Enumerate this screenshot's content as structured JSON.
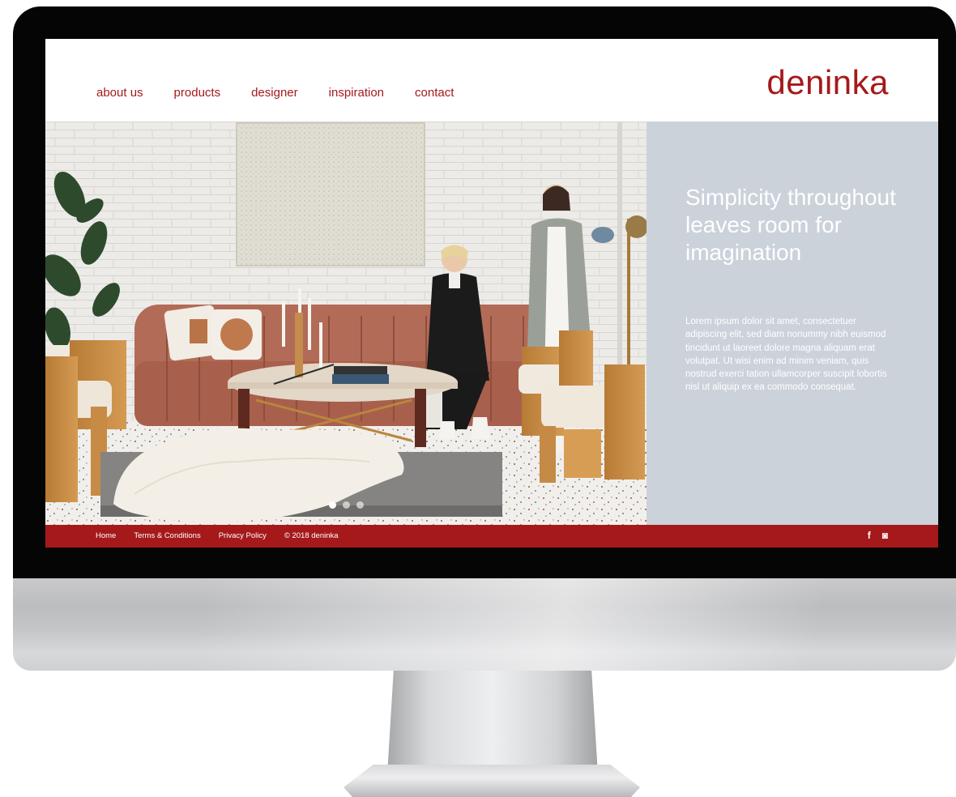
{
  "nav": {
    "items": [
      {
        "label": "about us"
      },
      {
        "label": "products"
      },
      {
        "label": "designer"
      },
      {
        "label": "inspiration"
      },
      {
        "label": "contact"
      }
    ]
  },
  "brand": {
    "logo_text": "deninka",
    "accent_color": "#a5191b",
    "panel_color": "#cbd2da"
  },
  "hero": {
    "headline": "Simplicity throughout leaves room for imagination",
    "body": "Lorem ipsum dolor sit amet, consectetuer adipiscing elit, sed diam nonummy nibh euismod tincidunt ut laoreet dolore magna aliquam erat volutpat. Ut wisi enim ad minim veniam, quis nostrud exerci tation ullamcorper suscipit lobortis nisl ut aliquip ex ea commodo consequat.",
    "slide_count": 3,
    "active_slide": 1
  },
  "footer": {
    "home": "Home",
    "terms": "Terms & Conditions",
    "privacy": "Privacy Policy",
    "copyright": "© 2018 deninka",
    "facebook_glyph": "f",
    "instagram_glyph": "◙",
    "social_icons": [
      "facebook-icon",
      "instagram-icon"
    ]
  }
}
